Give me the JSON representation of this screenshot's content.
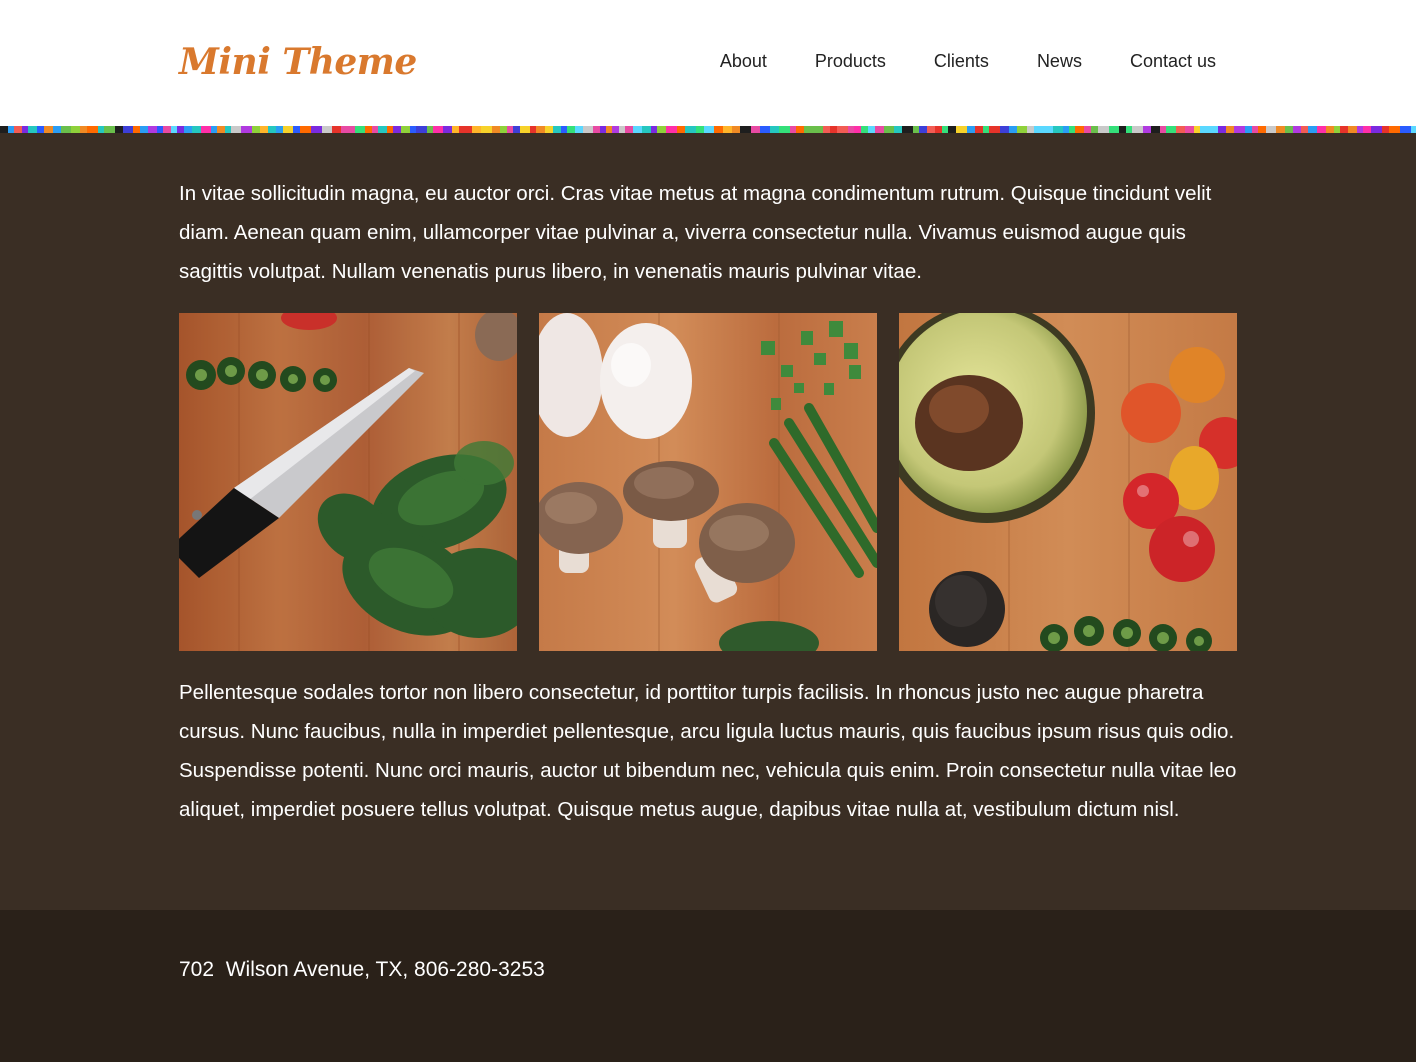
{
  "header": {
    "logo": "Mini Theme",
    "nav": [
      {
        "label": "About"
      },
      {
        "label": "Products"
      },
      {
        "label": "Clients"
      },
      {
        "label": "News"
      },
      {
        "label": "Contact us"
      }
    ]
  },
  "main": {
    "intro": "In vitae sollicitudin magna, eu auctor orci. Cras vitae metus at magna condimentum rutrum. Quisque tincidunt velit diam. Aenean quam enim, ullamcorper vitae pulvinar a, viverra consectetur nulla. Vivamus euismod augue quis sagittis volutpat. Nullam venenatis purus libero, in venenatis mauris pulvinar vitae.",
    "body": "Pellentesque sodales tortor non libero consectetur, id porttitor turpis facilisis. In rhoncus justo nec augue pharetra cursus. Nunc faucibus, nulla in imperdiet pellentesque, arcu ligula luctus mauris, quis faucibus ipsum risus quis odio. Suspendisse potenti. Nunc orci mauris, auctor ut bibendum nec, vehicula quis enim. Proin consectetur nulla vitae leo aliquet, imperdiet posuere tellus volutpat. Quisque metus augue, dapibus vitae nulla at, vestibulum dictum nisl.",
    "gallery": [
      "knife-spinach-photo",
      "eggs-mushrooms-photo",
      "avocado-tomatoes-photo"
    ]
  },
  "footer": {
    "address": "702  Wilson Avenue, TX, 806-280-3253"
  },
  "colors": {
    "header_bg": "#ffffff",
    "logo": "#d9792e",
    "main_bg": "#3a2e24",
    "footer_bg": "#2a2119",
    "text": "#ffffff"
  }
}
